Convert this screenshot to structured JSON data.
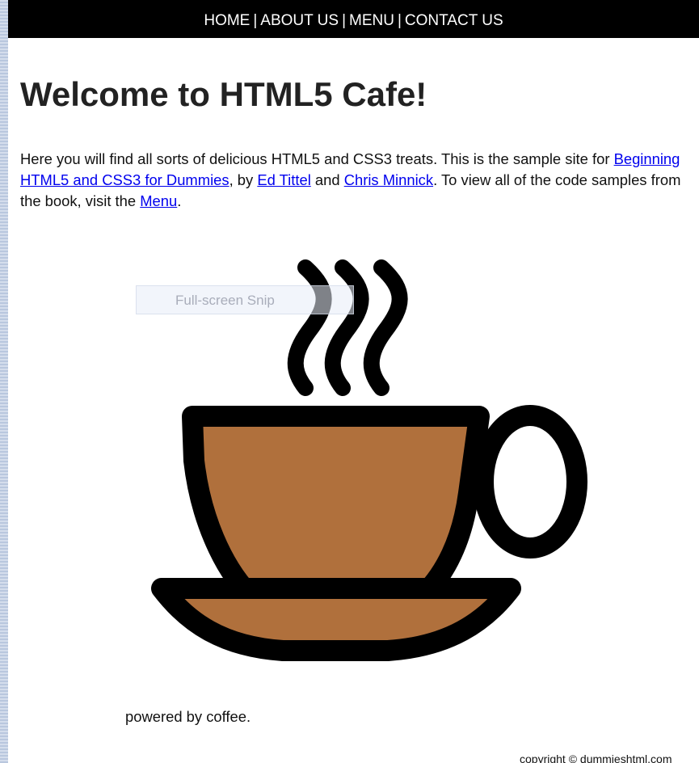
{
  "nav": {
    "home": "HOME",
    "about": "ABOUT US",
    "menu": "MENU",
    "contact": "CONTACT US",
    "separator": "|"
  },
  "heading": "Welcome to HTML5 Cafe!",
  "intro": {
    "text1": "Here you will find all sorts of delicious HTML5 and CSS3 treats. This is the sample site for ",
    "book_link": "Beginning HTML5 and CSS3 for Dummies",
    "text2": ", by ",
    "author1_link": "Ed Tittel",
    "text3": " and ",
    "author2_link": "Chris Minnick",
    "text4": ". To view all of the code samples from the book, visit the ",
    "menu_link": "Menu",
    "text5": "."
  },
  "snip_overlay": "Full-screen Snip",
  "powered": "powered by coffee.",
  "copyright": "copyright © dummieshtml.com",
  "colors": {
    "nav_bg": "#000000",
    "link": "#0000ee",
    "coffee": "#b0703c",
    "outline": "#000000"
  }
}
